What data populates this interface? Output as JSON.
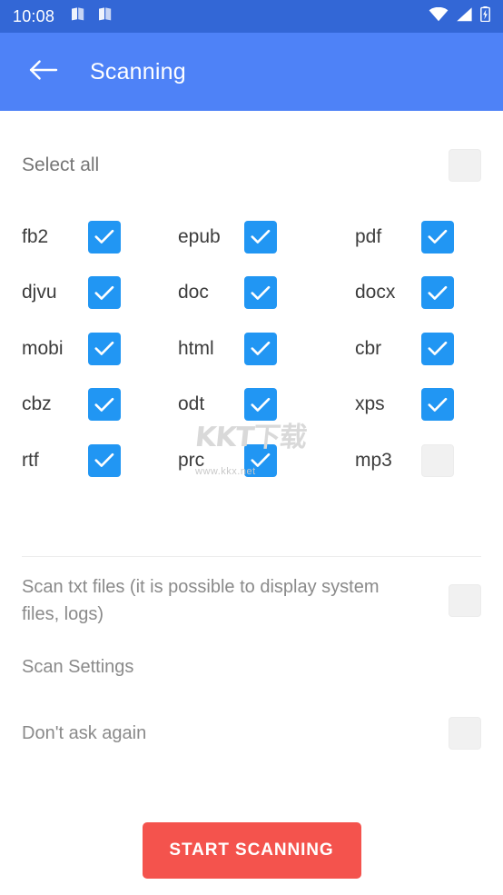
{
  "status_bar": {
    "time": "10:08",
    "left_icons": [
      "book-icon",
      "book-icon"
    ],
    "right_icons": [
      "wifi-icon",
      "signal-icon",
      "battery-charging-icon"
    ],
    "background_color": "#3367d6"
  },
  "app_bar": {
    "back_icon": "arrow-left-icon",
    "title": "Scanning",
    "background_color": "#4e82f7",
    "text_color": "#ffffff"
  },
  "select_all": {
    "label": "Select all",
    "checked": false
  },
  "formats": {
    "rows": [
      [
        {
          "label": "fb2",
          "checked": true
        },
        {
          "label": "epub",
          "checked": true
        },
        {
          "label": "pdf",
          "checked": true
        }
      ],
      [
        {
          "label": "djvu",
          "checked": true
        },
        {
          "label": "doc",
          "checked": true
        },
        {
          "label": "docx",
          "checked": true
        }
      ],
      [
        {
          "label": "mobi",
          "checked": true
        },
        {
          "label": "html",
          "checked": true
        },
        {
          "label": "cbr",
          "checked": true
        }
      ],
      [
        {
          "label": "cbz",
          "checked": true
        },
        {
          "label": "odt",
          "checked": true
        },
        {
          "label": "xps",
          "checked": true
        }
      ],
      [
        {
          "label": "rtf",
          "checked": true
        },
        {
          "label": "prc",
          "checked": true
        },
        {
          "label": "mp3",
          "checked": false
        }
      ]
    ]
  },
  "watermark": {
    "main": "KKT下载",
    "sub": "www.kkx.net"
  },
  "settings": {
    "scan_txt": {
      "label": "Scan txt files (it is possible to display system files, logs)",
      "checked": false
    },
    "scan_settings": {
      "label": "Scan Settings"
    },
    "dont_ask_again": {
      "label": "Don't ask again",
      "checked": false
    }
  },
  "action": {
    "start_label": "START SCANNING",
    "color": "#f4534d"
  },
  "colors": {
    "checkbox_checked": "#2196f3",
    "checkbox_unchecked": "#f1f1f1",
    "accent_red": "#f4534d",
    "app_bar_blue": "#4e82f7",
    "status_bar_blue": "#3367d6"
  }
}
